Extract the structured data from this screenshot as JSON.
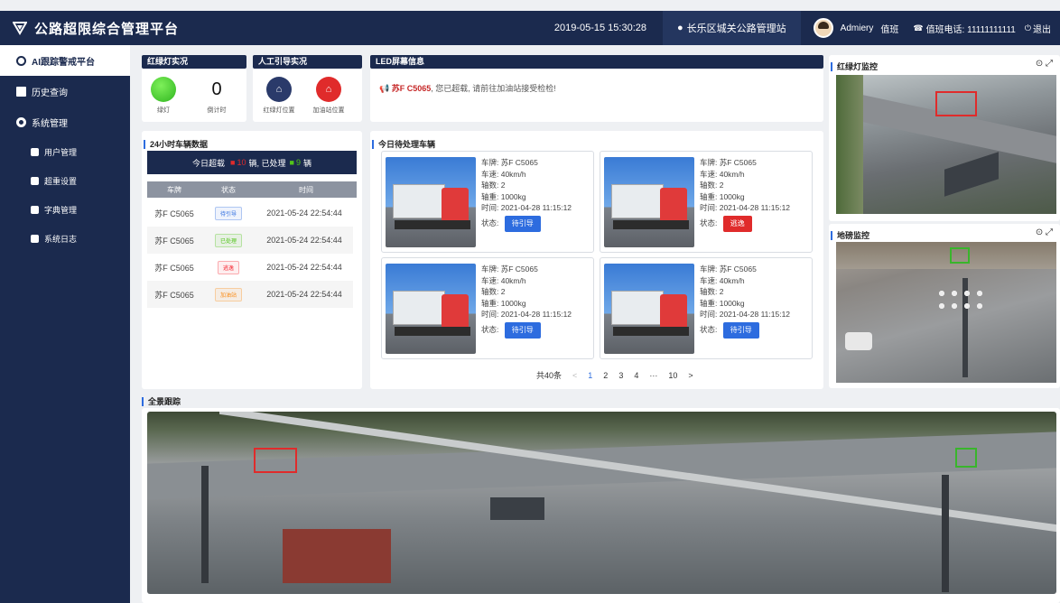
{
  "header": {
    "title": "公路超限综合管理平台",
    "datetime": "2019-05-15  15:30:28",
    "station": "长乐区城关公路管理站",
    "user": "Admiery",
    "duty": "值班",
    "phone_label": "值班电话: 11111111111",
    "logout": "退出"
  },
  "sidebar": {
    "items": [
      {
        "label": "AI跟踪警戒平台",
        "active": true,
        "sub": false
      },
      {
        "label": "历史查询",
        "sub": false
      },
      {
        "label": "系统管理",
        "sub": false
      },
      {
        "label": "用户管理",
        "sub": true
      },
      {
        "label": "超重设置",
        "sub": true
      },
      {
        "label": "字典管理",
        "sub": true
      },
      {
        "label": "系统日志",
        "sub": true
      }
    ]
  },
  "light": {
    "header": "红绿灯实况",
    "green_label": "绿灯",
    "countdown_value": "0",
    "countdown_label": "倒计时"
  },
  "guide": {
    "header": "人工引导实况",
    "btn1": "红绿灯位置",
    "btn2": "加油站位置"
  },
  "led": {
    "header": "LED屏幕信息",
    "plate": "苏F C5065",
    "message": ", 您已超载, 请前往加油站接受检检!"
  },
  "stats": {
    "title": "24小时车辆数据",
    "prefix": "今日超载",
    "count1": "10",
    "mid": "辆, 已处理",
    "count2": "9",
    "suffix": "辆",
    "columns": [
      "车牌",
      "状态",
      "时间"
    ],
    "rows": [
      {
        "plate": "苏F C5065",
        "status": "待引导",
        "time": "2021-05-24 22:54:44",
        "color": "#2d6cdf"
      },
      {
        "plate": "苏F C5065",
        "status": "已处理",
        "time": "2021-05-24 22:54:44",
        "color": "#52c41a"
      },
      {
        "plate": "苏F C5065",
        "status": "逃逸",
        "time": "2021-05-24 22:54:44",
        "color": "#f5222d"
      },
      {
        "plate": "苏F C5065",
        "status": "加油站",
        "time": "2021-05-24 22:54:44",
        "color": "#fa8c16"
      }
    ]
  },
  "pending": {
    "title": "今日待处理车辆",
    "vehicles": [
      {
        "plate": "车牌: 苏F C5065",
        "speed": "车速: 40km/h",
        "axle": "轴数: 2",
        "weight": "轴重: 1000kg",
        "time": "时间: 2021-04-28 11:15:12",
        "status_label": "状态:",
        "status": "待引导",
        "color": "#2d6cdf"
      },
      {
        "plate": "车牌: 苏F C5065",
        "speed": "车速: 40km/h",
        "axle": "轴数: 2",
        "weight": "轴重: 1000kg",
        "time": "时间: 2021-04-28 11:15:12",
        "status_label": "状态:",
        "status": "逃逸",
        "color": "#e02b2b"
      },
      {
        "plate": "车牌: 苏F C5065",
        "speed": "车速: 40km/h",
        "axle": "轴数: 2",
        "weight": "轴重: 1000kg",
        "time": "时间: 2021-04-28 11:15:12",
        "status_label": "状态:",
        "status": "待引导",
        "color": "#2d6cdf"
      },
      {
        "plate": "车牌: 苏F C5065",
        "speed": "车速: 40km/h",
        "axle": "轴数: 2",
        "weight": "轴重: 1000kg",
        "time": "时间: 2021-04-28 11:15:12",
        "status_label": "状态:",
        "status": "待引导",
        "color": "#2d6cdf"
      }
    ],
    "pager": {
      "total": "共40条",
      "prev": "<",
      "pages": [
        "1",
        "2",
        "3",
        "4",
        "···",
        "10"
      ],
      "next": ">"
    }
  },
  "cams": {
    "light_title": "红绿灯监控",
    "weigh_title": "地磅监控",
    "pano_title": "全景跟踪"
  }
}
